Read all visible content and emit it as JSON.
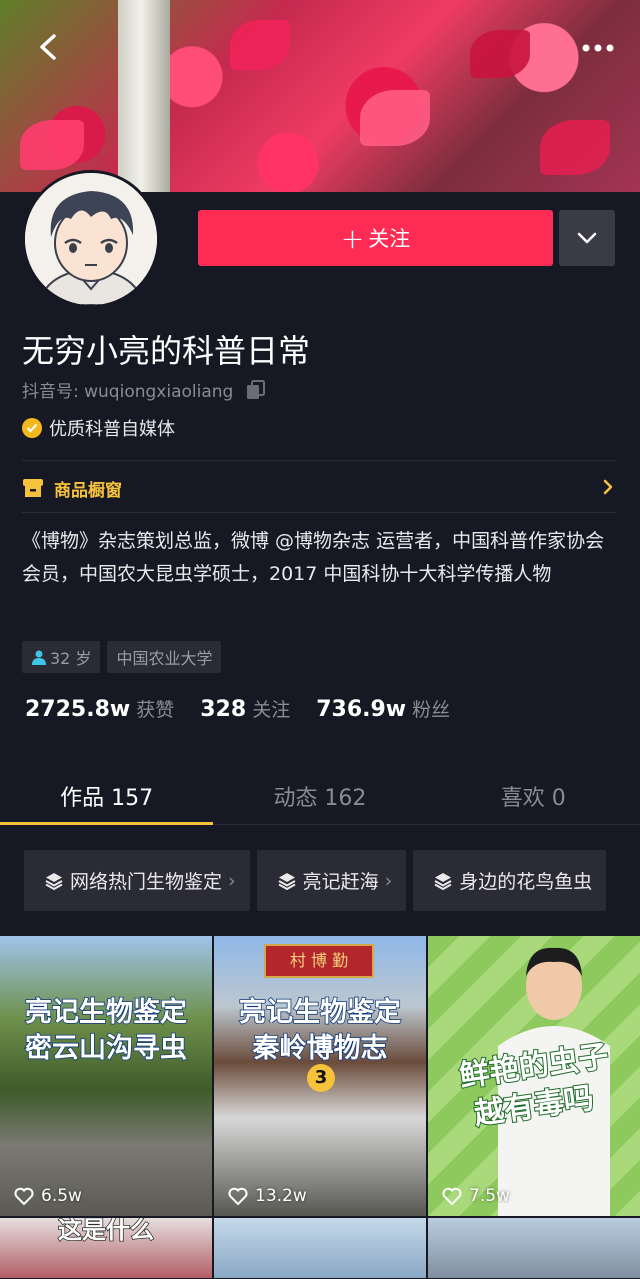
{
  "header": {
    "back_icon": "chevron-left-icon",
    "more_icon": "ellipsis-icon"
  },
  "profile": {
    "name": "无穷小亮的科普日常",
    "douyin_id": "抖音号: wuqiongxiaoliang",
    "verified_label": "优质科普自媒体",
    "follow_label": "关注",
    "shop_label": "商品橱窗",
    "bio": "《博物》杂志策划总监，微博 @博物杂志 运营者，中国科普作家协会会员，中国农大昆虫学硕士，2017 中国科协十大科学传播人物",
    "tags": {
      "age": "32 岁",
      "school": "中国农业大学"
    },
    "stats": [
      {
        "value": "2725.8w",
        "label": "获赞"
      },
      {
        "value": "328",
        "label": "关注"
      },
      {
        "value": "736.9w",
        "label": "粉丝"
      }
    ]
  },
  "tabs": [
    {
      "label": "作品 157",
      "active": true
    },
    {
      "label": "动态 162",
      "active": false
    },
    {
      "label": "喜欢 0",
      "active": false
    }
  ],
  "collections": [
    {
      "label": "网络热门生物鉴定"
    },
    {
      "label": "亮记赶海"
    },
    {
      "label": "身边的花鸟鱼虫"
    }
  ],
  "videos": [
    {
      "title_line1": "亮记生物鉴定",
      "title_line2": "密云山沟寻虫",
      "likes": "6.5w"
    },
    {
      "title_line1": "亮记生物鉴定",
      "title_line2": "秦岭博物志",
      "badge": "3",
      "sign": "村 博 勤",
      "likes": "13.2w"
    },
    {
      "title_line1": "鲜艳的虫子",
      "title_line2": "越有毒吗",
      "likes": "7.5w"
    }
  ],
  "second_row": {
    "partial_text": "这是什么"
  },
  "colors": {
    "accent": "#fe2c55",
    "highlight": "#f6c23b",
    "background": "#161823"
  }
}
